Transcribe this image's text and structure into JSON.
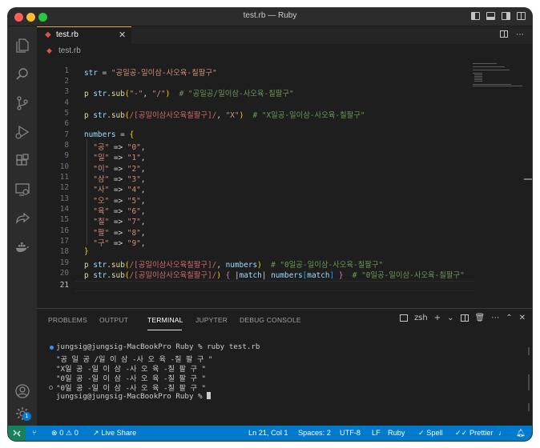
{
  "window": {
    "title": "test.rb — Ruby"
  },
  "tab": {
    "filename": "test.rb",
    "close": "✕",
    "lang_glyph": "◆"
  },
  "breadcrumb": {
    "filename": "test.rb"
  },
  "editor": {
    "line_numbers": [
      "1",
      "2",
      "3",
      "4",
      "5",
      "6",
      "7",
      "8",
      "9",
      "10",
      "11",
      "12",
      "13",
      "14",
      "15",
      "16",
      "17",
      "18",
      "19",
      "20",
      "21"
    ],
    "current_line": "21"
  },
  "panel": {
    "tabs": [
      "PROBLEMS",
      "OUTPUT",
      "TERMINAL",
      "JUPYTER",
      "DEBUG CONSOLE"
    ],
    "active_tab": "TERMINAL",
    "shell": "zsh",
    "terminal_lines": [
      "jungsig@jungsig-MacBookPro Ruby % ruby test.rb",
      "\"공 일 공 /일 이 삼 -사 오 육 -칠 팔 구 \"",
      "\"X일 공 -일 이 삼 -사 오 육 -칠 팔 구 \"",
      "\"0일 공 -일 이 삼 -사 오 육 -칠 팔 구 \"",
      "\"0일 공 -일 이 삼 -사 오 육 -칠 팔 구 \"",
      "jungsig@jungsig-MacBookPro Ruby % "
    ]
  },
  "statusbar": {
    "errors": "0",
    "warnings": "0",
    "live_share": "Live Share",
    "position": "Ln 21, Col 1",
    "spaces": "Spaces: 2",
    "encoding": "UTF-8",
    "eol": "LF",
    "language": "Ruby",
    "spell": "Spell",
    "prettier": "Prettier"
  },
  "activity": {
    "badge": "1"
  },
  "colors": {
    "accent": "#007acc",
    "tab_top": "#e8ab53",
    "remote": "#16825d"
  }
}
